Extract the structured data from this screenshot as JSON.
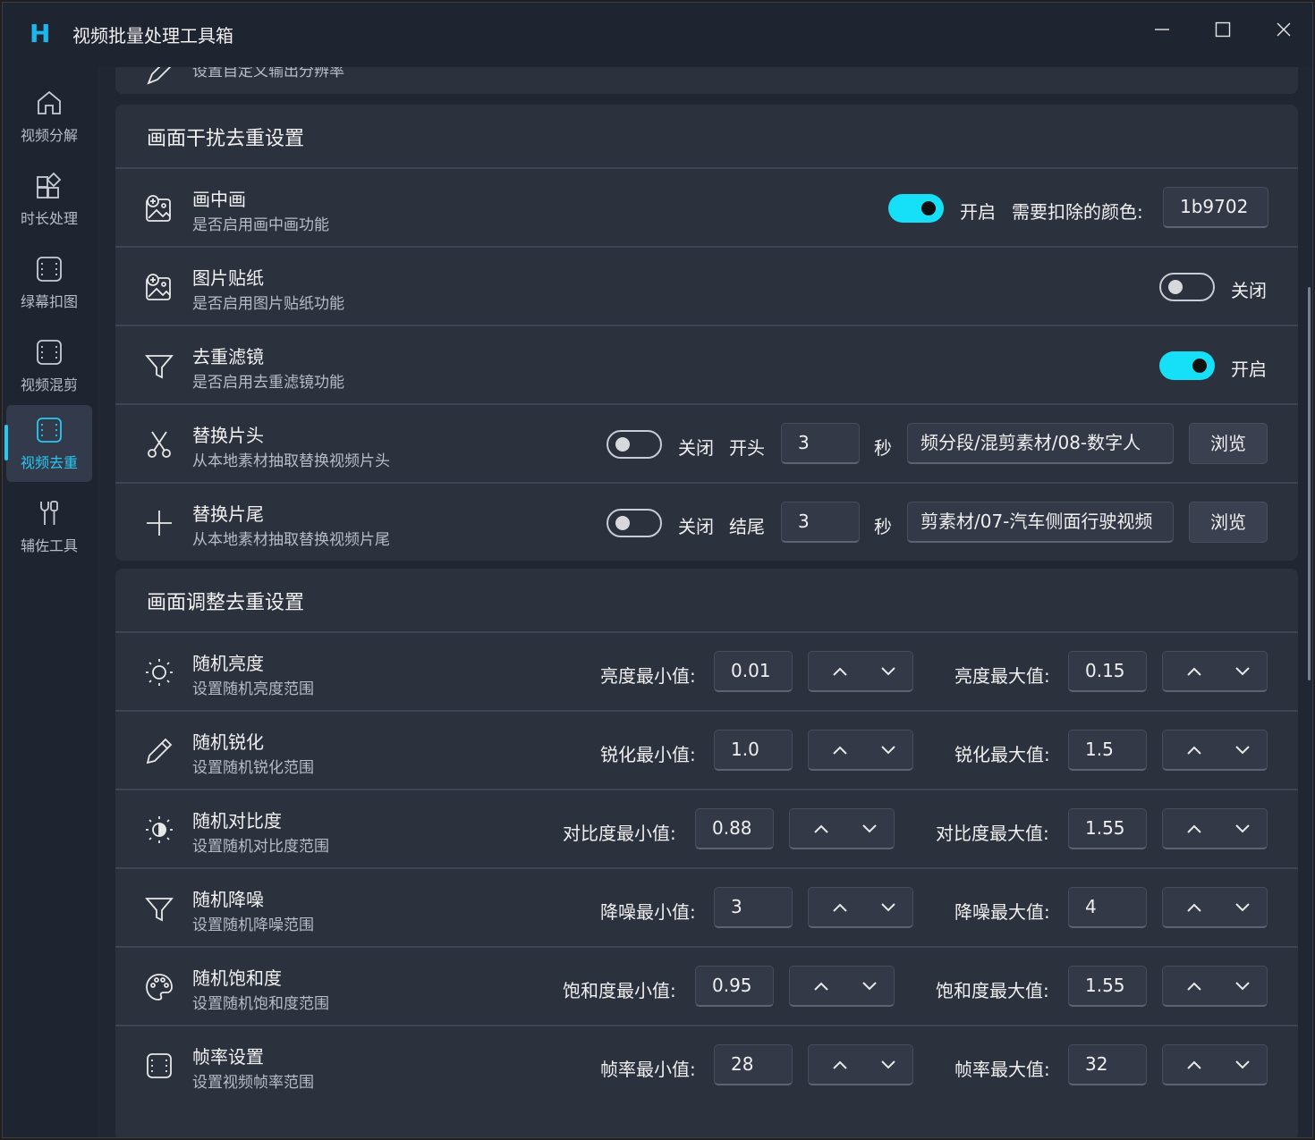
{
  "app": {
    "title": "视频批量处理工具箱",
    "logo": "H"
  },
  "sidebar": {
    "items": [
      {
        "label": "视频分解",
        "icon": "home-icon",
        "active": false
      },
      {
        "label": "时长处理",
        "icon": "apps-add-icon",
        "active": false
      },
      {
        "label": "绿幕扣图",
        "icon": "film-frame-icon",
        "active": false
      },
      {
        "label": "视频混剪",
        "icon": "film-frame-icon",
        "active": false
      },
      {
        "label": "视频去重",
        "icon": "film-frame-icon",
        "active": true
      },
      {
        "label": "辅佐工具",
        "icon": "tools-icon",
        "active": false
      }
    ]
  },
  "prev_card": {
    "desc": "设置自定义输出分辨率"
  },
  "interference": {
    "title": "画面干扰去重设置",
    "rows": [
      {
        "title": "画中画",
        "desc": "是否启用画中画功能",
        "icon": "image-add-icon",
        "toggle_on": true,
        "toggle_label": "开启",
        "color_label": "需要扣除的颜色:",
        "color_value": "1b9702"
      },
      {
        "title": "图片贴纸",
        "desc": "是否启用图片贴纸功能",
        "icon": "image-add-icon",
        "toggle_on": false,
        "toggle_label": "关闭"
      },
      {
        "title": "去重滤镜",
        "desc": "是否启用去重滤镜功能",
        "icon": "filter-icon",
        "toggle_on": true,
        "toggle_label": "开启"
      },
      {
        "title": "替换片头",
        "desc": "从本地素材抽取替换视频片头",
        "icon": "scissors-icon",
        "toggle_on": false,
        "toggle_label": "关闭",
        "pos_label": "开头",
        "seconds": "3",
        "unit": "秒",
        "path": "频分段/混剪素材/08-数字人",
        "browse": "浏览"
      },
      {
        "title": "替换片尾",
        "desc": "从本地素材抽取替换视频片尾",
        "icon": "plus-icon",
        "toggle_on": false,
        "toggle_label": "关闭",
        "pos_label": "结尾",
        "seconds": "3",
        "unit": "秒",
        "path": "剪素材/07-汽车侧面行驶视频",
        "browse": "浏览"
      }
    ]
  },
  "adjust": {
    "title": "画面调整去重设置",
    "rows": [
      {
        "title": "随机亮度",
        "desc": "设置随机亮度范围",
        "icon": "sun-icon",
        "min_label": "亮度最小值:",
        "min": "0.01",
        "max_label": "亮度最大值:",
        "max": "0.15"
      },
      {
        "title": "随机锐化",
        "desc": "设置随机锐化范围",
        "icon": "pencil-icon",
        "min_label": "锐化最小值:",
        "min": "1.0",
        "max_label": "锐化最大值:",
        "max": "1.5"
      },
      {
        "title": "随机对比度",
        "desc": "设置随机对比度范围",
        "icon": "contrast-icon",
        "min_label": "对比度最小值:",
        "min": "0.88",
        "max_label": "对比度最大值:",
        "max": "1.55"
      },
      {
        "title": "随机降噪",
        "desc": "设置随机降噪范围",
        "icon": "filter-icon",
        "min_label": "降噪最小值:",
        "min": "3",
        "max_label": "降噪最大值:",
        "max": "4"
      },
      {
        "title": "随机饱和度",
        "desc": "设置随机饱和度范围",
        "icon": "palette-icon",
        "min_label": "饱和度最小值:",
        "min": "0.95",
        "max_label": "饱和度最大值:",
        "max": "1.55"
      },
      {
        "title": "帧率设置",
        "desc": "设置视频帧率范围",
        "icon": "film-frame-icon",
        "min_label": "帧率最小值:",
        "min": "28",
        "max_label": "帧率最大值:",
        "max": "32"
      }
    ]
  },
  "colors": {
    "accent": "#29c8f0",
    "toggle_on": "#16e0f7",
    "card": "#2c313e",
    "bg": "#212633"
  }
}
